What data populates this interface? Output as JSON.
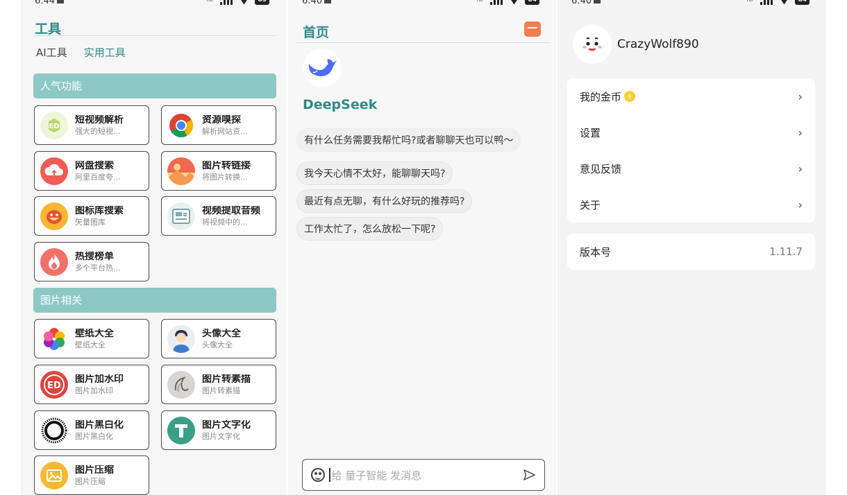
{
  "screen_tools": {
    "status": {
      "time": "6:44",
      "signal_label": "HD",
      "battery": "83"
    },
    "title": "工具",
    "tabs": [
      "AI工具",
      "实用工具"
    ],
    "sections": [
      {
        "title": "人气功能",
        "items": [
          {
            "name": "短视频解析",
            "desc": "强大的短视..."
          },
          {
            "name": "资源嗅探",
            "desc": "解析网站资..."
          },
          {
            "name": "网盘搜索",
            "desc": "阿里百度夸..."
          },
          {
            "name": "图片转链接",
            "desc": "将图片转换..."
          },
          {
            "name": "图标库搜索",
            "desc": "矢量图库"
          },
          {
            "name": "视频提取音频",
            "desc": "将视频中的..."
          },
          {
            "name": "热搜榜单",
            "desc": "多个平台热..."
          }
        ]
      },
      {
        "title": "图片相关",
        "items": [
          {
            "name": "壁纸大全",
            "desc": "壁纸大全"
          },
          {
            "name": "头像大全",
            "desc": "头像大全"
          },
          {
            "name": "图片加水印",
            "desc": "图片加水印"
          },
          {
            "name": "图片转素描",
            "desc": "图片转素描"
          },
          {
            "name": "图片黑白化",
            "desc": "图片黑白化"
          },
          {
            "name": "图片文字化",
            "desc": "图片文字化"
          },
          {
            "name": "图片压缩",
            "desc": "图片压缩"
          }
        ]
      }
    ]
  },
  "screen_chat": {
    "status": {
      "time": "6:40",
      "signal_label": "HD",
      "battery": "84"
    },
    "title": "首页",
    "bot_name": "DeepSeek",
    "greeting": "有什么任务需要我帮忙吗?或者聊聊天也可以鸭～",
    "suggestions": [
      "我今天心情不太好，能聊聊天吗?",
      "最近有点无聊，有什么好玩的推荐吗?",
      "工作太忙了，怎么放松一下呢?"
    ],
    "input_placeholder": "给 量子智能 发消息"
  },
  "screen_profile": {
    "status": {
      "time": "6:40",
      "signal_label": "HD",
      "battery": "84"
    },
    "username": "CrazyWolf890",
    "menu": [
      {
        "label": "我的金币",
        "has_coin": true
      },
      {
        "label": "设置"
      },
      {
        "label": "意见反馈"
      },
      {
        "label": "关于"
      }
    ],
    "version": {
      "label": "版本号",
      "value": "1.11.7"
    }
  },
  "colors": {
    "accent": "#2e8b88",
    "section_header": "#8cc9c5",
    "gift": "#f27d4f",
    "coin": "#f6cf3a"
  },
  "icons": {
    "tools_section_1": [
      "video-parse-icon",
      "chrome-icon",
      "cloud-upload-icon",
      "sunset-image-icon",
      "icon-library-icon",
      "video-audio-icon",
      "hot-flame-icon"
    ],
    "tools_section_2": [
      "petal-flower-icon",
      "avatar-boy-icon",
      "watermark-stamp-icon",
      "sketch-icon",
      "black-white-ring-icon",
      "text-t-icon",
      "compress-image-icon"
    ]
  }
}
